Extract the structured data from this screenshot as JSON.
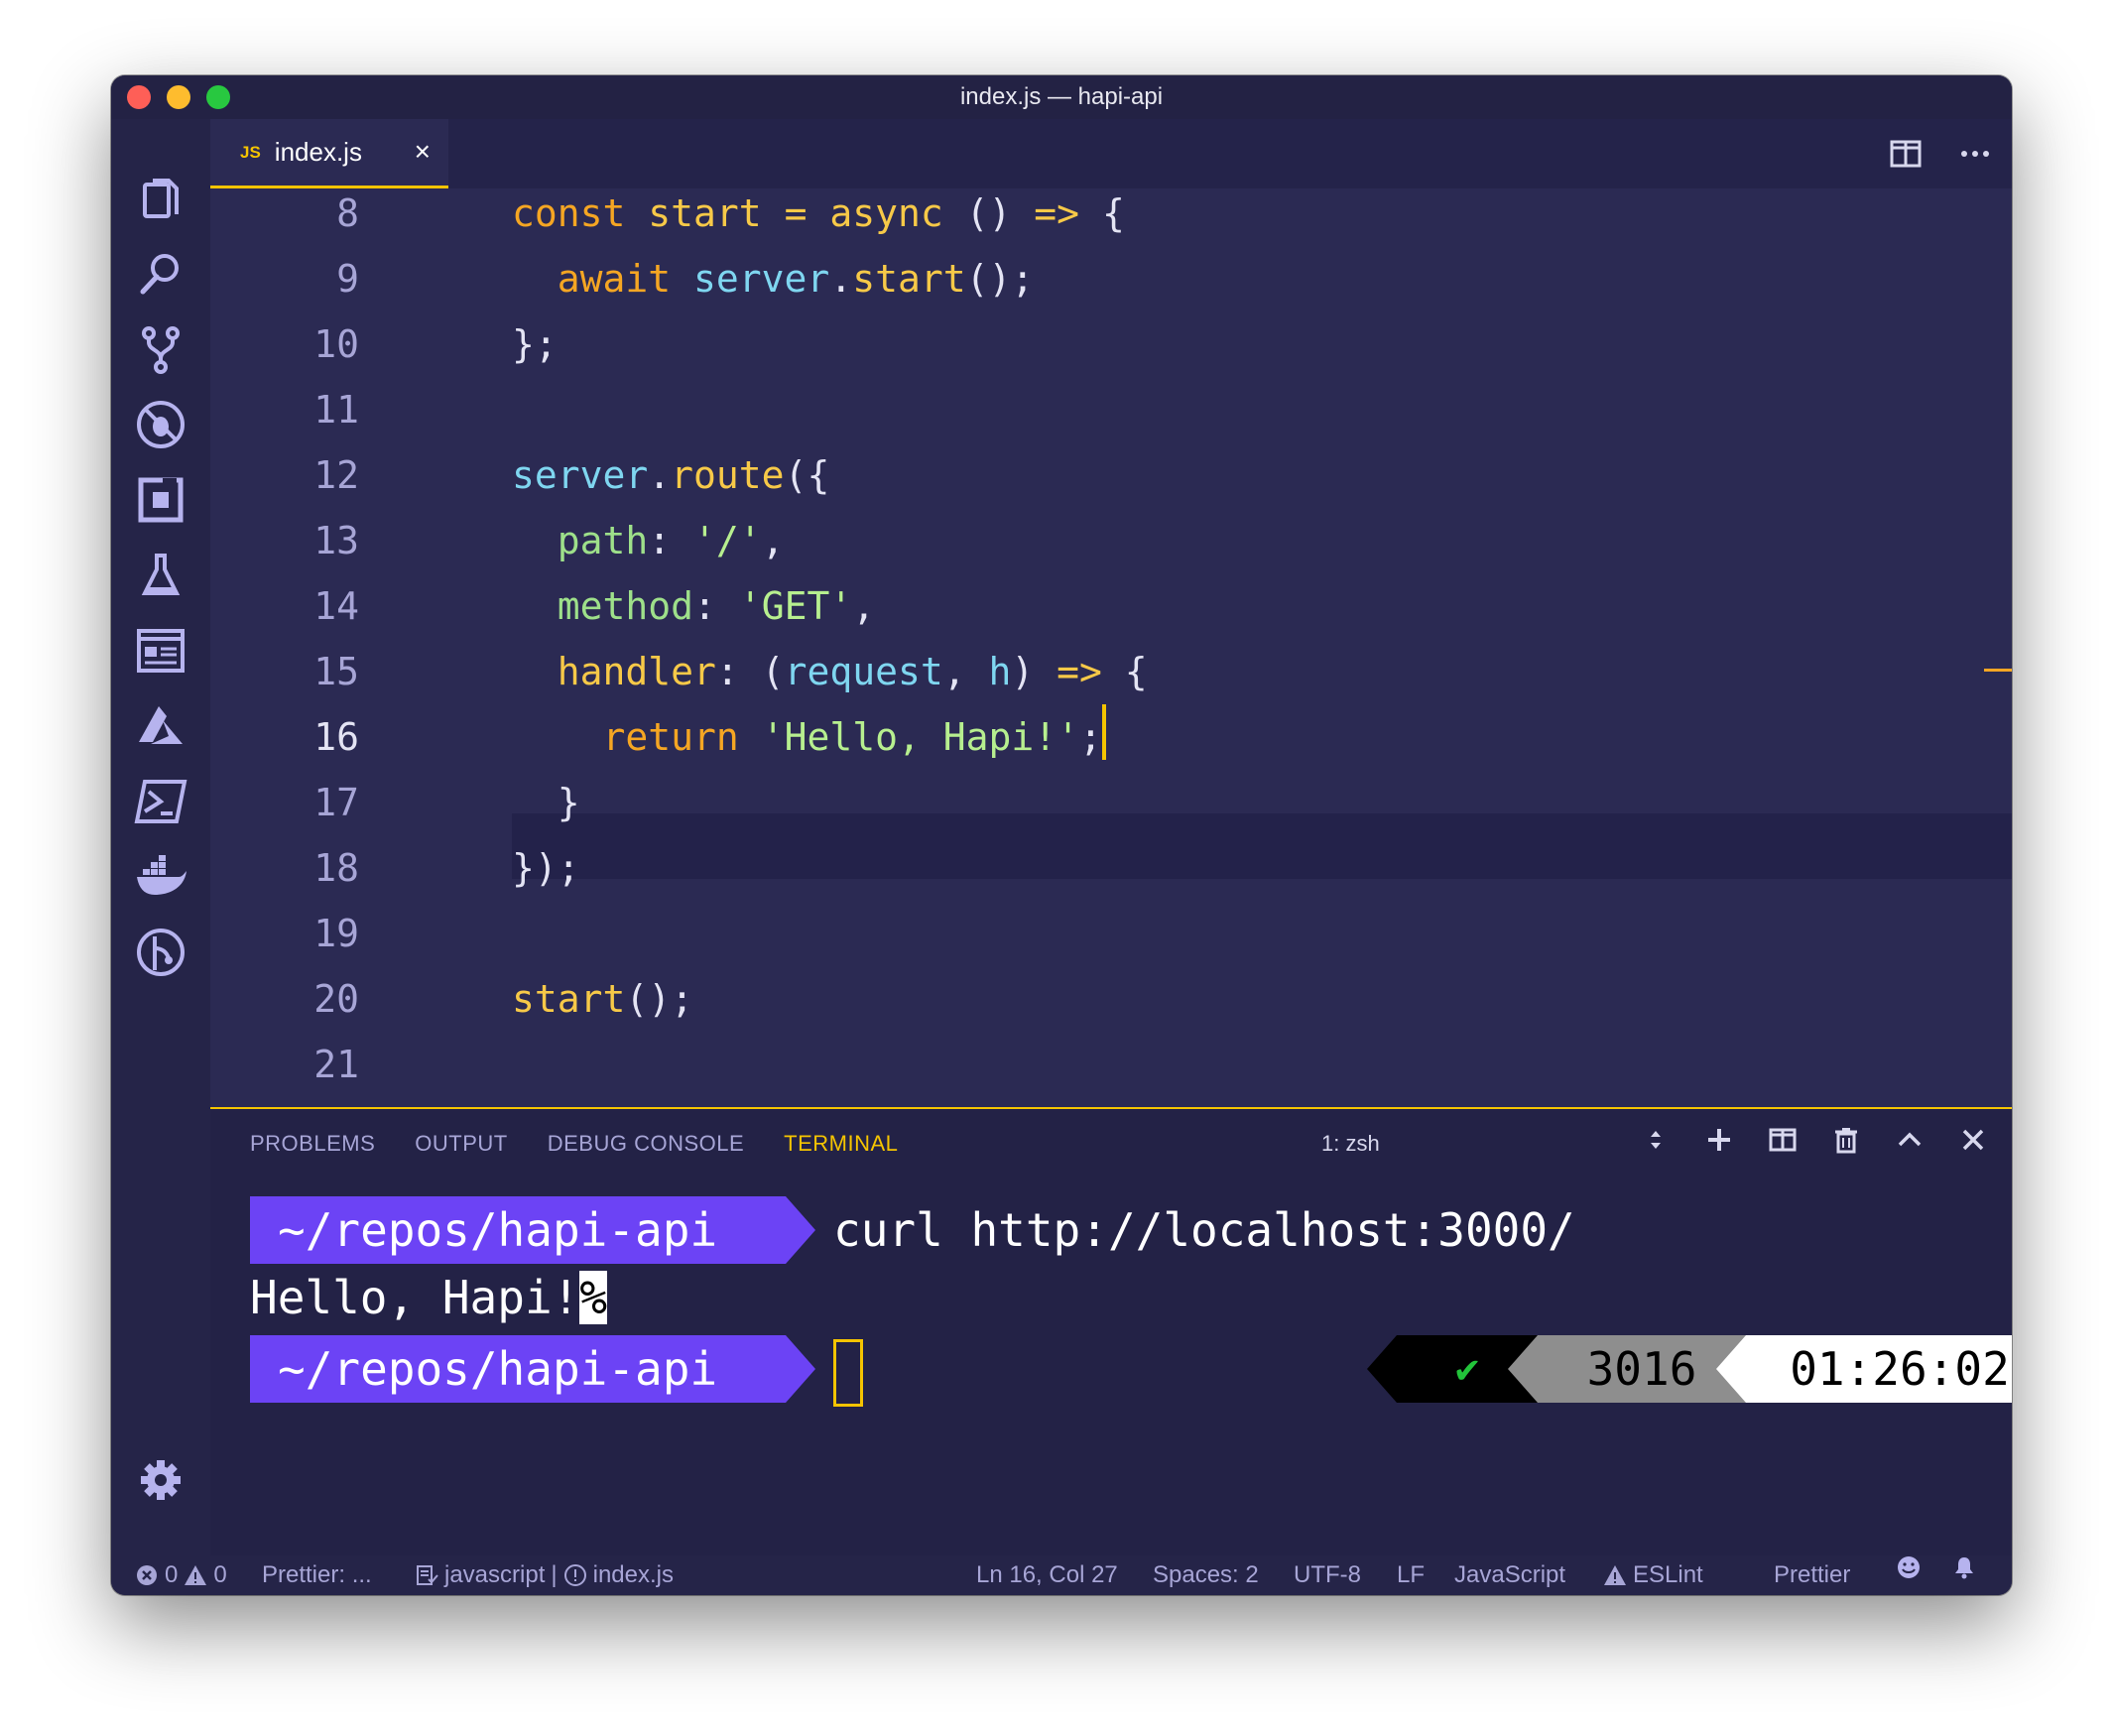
{
  "window": {
    "title": "index.js — hapi-api"
  },
  "tab": {
    "lang_badge": "JS",
    "file_name": "index.js",
    "close": "×"
  },
  "editor": {
    "lines": [
      {
        "n": "8"
      },
      {
        "n": "9"
      },
      {
        "n": "10"
      },
      {
        "n": "11"
      },
      {
        "n": "12"
      },
      {
        "n": "13"
      },
      {
        "n": "14"
      },
      {
        "n": "15"
      },
      {
        "n": "16"
      },
      {
        "n": "17"
      },
      {
        "n": "18"
      },
      {
        "n": "19"
      },
      {
        "n": "20"
      },
      {
        "n": "21"
      }
    ],
    "code": {
      "l8": {
        "a": "const",
        "b": "start",
        "c": "=",
        "d": "async",
        "e": "()",
        "f": "=>",
        "g": "{"
      },
      "l9": {
        "a": "await",
        "b": "server",
        "c": ".",
        "d": "start",
        "e": "();"
      },
      "l10": {
        "a": "};"
      },
      "l12": {
        "a": "server",
        "b": ".",
        "c": "route",
        "d": "({"
      },
      "l13": {
        "a": "path",
        "b": ": ",
        "c": "'/'",
        "d": ","
      },
      "l14": {
        "a": "method",
        "b": ": ",
        "c": "'GET'",
        "d": ","
      },
      "l15": {
        "a": "handler",
        "b": ": (",
        "c": "request",
        "d": ", ",
        "e": "h",
        "f": ") ",
        "g": "=>",
        "h": " {"
      },
      "l16": {
        "a": "return",
        "b": "'Hello, Hapi!'",
        "c": ";"
      },
      "l17": {
        "a": "}"
      },
      "l18": {
        "a": "});"
      },
      "l20": {
        "a": "start",
        "b": "();"
      }
    }
  },
  "panel": {
    "tabs": [
      "PROBLEMS",
      "OUTPUT",
      "DEBUG CONSOLE",
      "TERMINAL"
    ],
    "active_tab": "TERMINAL",
    "terminal_select": "1: zsh"
  },
  "terminal": {
    "prompt_path": "~/repos/hapi-api",
    "command": "curl http://localhost:3000/",
    "output": "Hello, Hapi!",
    "output_marker": "%",
    "status_check": "✔",
    "history_number": "3016",
    "time": "01:26:02"
  },
  "statusbar": {
    "errors": "0",
    "warnings": "0",
    "prettier_left": "Prettier: ...",
    "language_server": "javascript",
    "separator": "|",
    "file": "index.js",
    "cursor_pos": "Ln 16, Col 27",
    "spaces": "Spaces: 2",
    "encoding": "UTF-8",
    "eol": "LF",
    "language": "JavaScript",
    "eslint": "ESLint",
    "prettier_right": "Prettier"
  },
  "colors": {
    "accent": "#f5c400",
    "prompt_bg": "#6c43f5",
    "editor_bg": "#2b2a53"
  }
}
